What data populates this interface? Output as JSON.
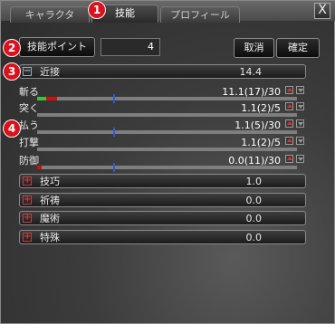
{
  "tabs": [
    {
      "label": "キャラクタ",
      "active": false
    },
    {
      "label": "技能",
      "active": true
    },
    {
      "label": "プロフィール",
      "active": false
    }
  ],
  "close_label": "X",
  "badges": [
    "1",
    "2",
    "3",
    "4"
  ],
  "points": {
    "label": "技能ポイント",
    "value": "4"
  },
  "buttons": {
    "cancel": "取消",
    "confirm": "確定"
  },
  "categories": {
    "melee": {
      "label": "近接",
      "value": "14.4",
      "expanded": true
    },
    "technique": {
      "label": "技巧",
      "value": "1.0",
      "expanded": false
    },
    "prayer": {
      "label": "祈祷",
      "value": "0.0",
      "expanded": false
    },
    "magic": {
      "label": "魔術",
      "value": "0.0",
      "expanded": false
    },
    "special": {
      "label": "特殊",
      "value": "0.0",
      "expanded": false
    }
  },
  "skills": [
    {
      "name": "斬る",
      "value": "11.1(17)/30",
      "progress_pct": 8
    },
    {
      "name": "突く",
      "value": "1.1(2)/5",
      "progress_pct": 0
    },
    {
      "name": "払う",
      "value": "1.1(5)/30",
      "progress_pct": 0
    },
    {
      "name": "打撃",
      "value": "1.1(2)/5",
      "progress_pct": 0
    },
    {
      "name": "防御",
      "value": "0.0(11)/30",
      "progress_pct": 1
    }
  ],
  "colors": {
    "fill_red": "#d01010",
    "fill_green": "#3cc23c",
    "marker": "#2a5bd8"
  }
}
